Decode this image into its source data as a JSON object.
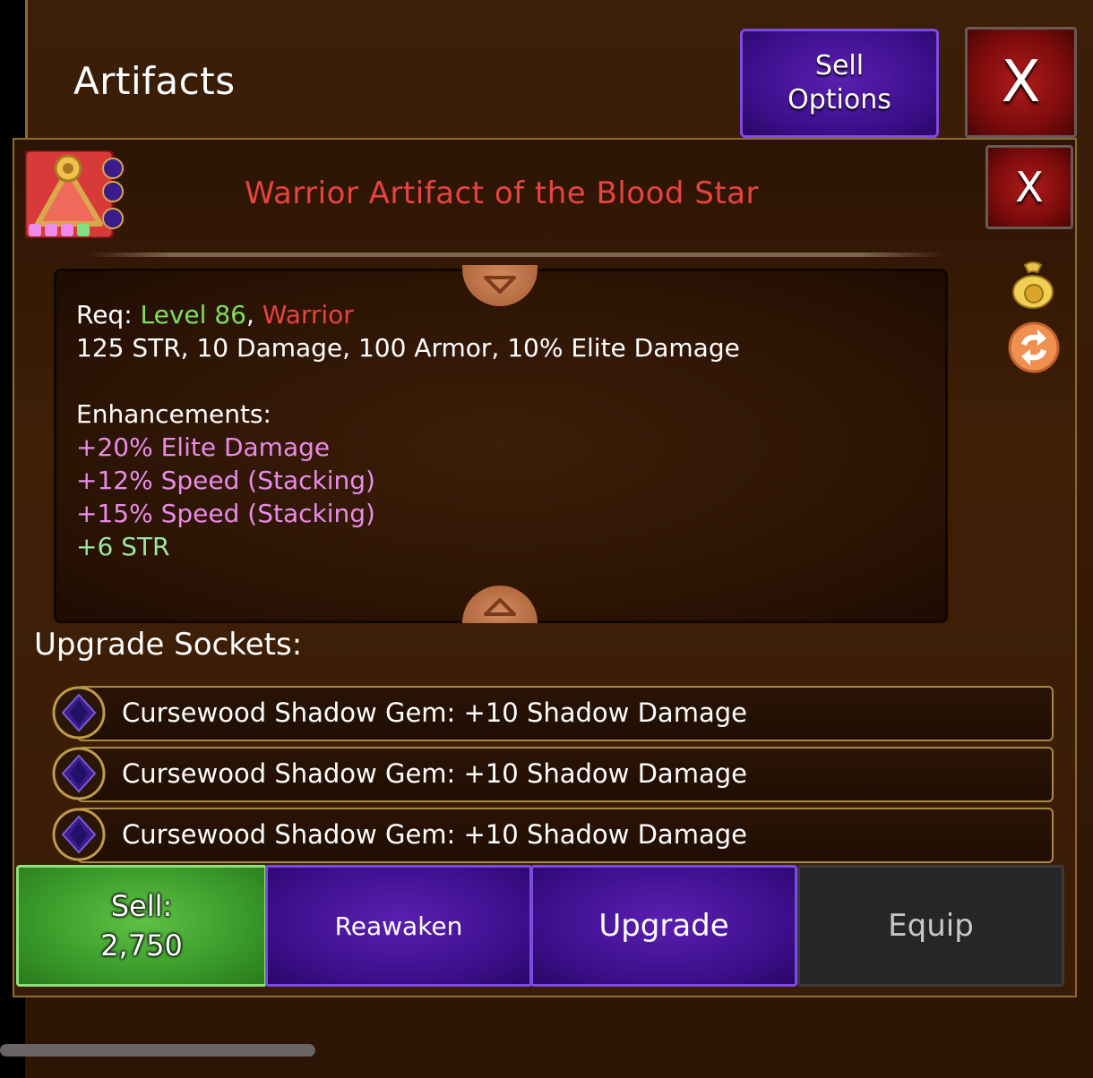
{
  "header": {
    "title": "Artifacts",
    "sell_options_label": "Sell\nOptions",
    "close_label": "X"
  },
  "item": {
    "name": "Warrior Artifact of the Blood Star",
    "close_label": "X",
    "rarity_color": "#e8433f",
    "icon": "triangle-artifact-icon",
    "req_prefix": "Req: ",
    "req_level": "Level 86",
    "req_sep": ", ",
    "req_class": "Warrior",
    "stats": "125 STR, 10 Damage, 100 Armor, 10% Elite Damage",
    "enhancements_title": "Enhancements:",
    "enhancements": [
      "+20% Elite Damage",
      "+12% Speed (Stacking)",
      "+15% Speed (Stacking)",
      "+6 STR"
    ]
  },
  "sockets": {
    "title": "Upgrade Sockets:",
    "items": [
      "Cursewood Shadow Gem: +10 Shadow Damage",
      "Cursewood Shadow Gem: +10 Shadow Damage",
      "Cursewood Shadow Gem: +10 Shadow Damage"
    ]
  },
  "actions": {
    "sell": "Sell:\n2,750",
    "reawaken": "Reawaken",
    "upgrade": "Upgrade",
    "equip": "Equip"
  },
  "colors": {
    "sell_green": "#3a9a2a",
    "purple": "#3d0f8c",
    "close_red": "#7e0c0c",
    "gold": "#a88a44"
  }
}
